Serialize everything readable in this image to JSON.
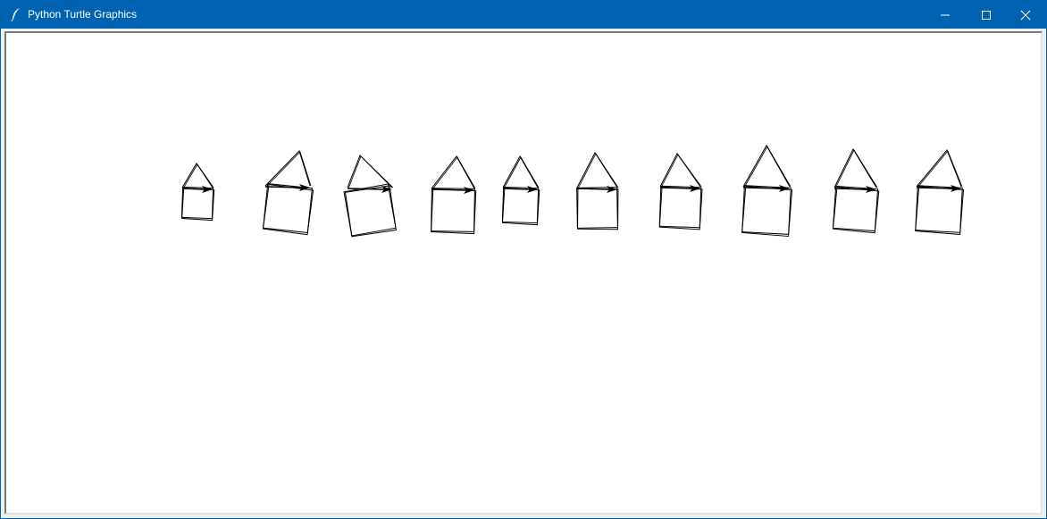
{
  "window": {
    "title": "Python Turtle Graphics",
    "icon": "feather-icon",
    "controls": [
      "minimize-icon",
      "maximize-icon",
      "close-icon"
    ],
    "accent_color": "#0063b1"
  },
  "canvas": {
    "background": "#ffffff",
    "pen_color": "#000000",
    "turtle_shape": "classic-arrow",
    "drawing": "row of house outlines (square base with triangular roof)",
    "house_count": 10
  }
}
